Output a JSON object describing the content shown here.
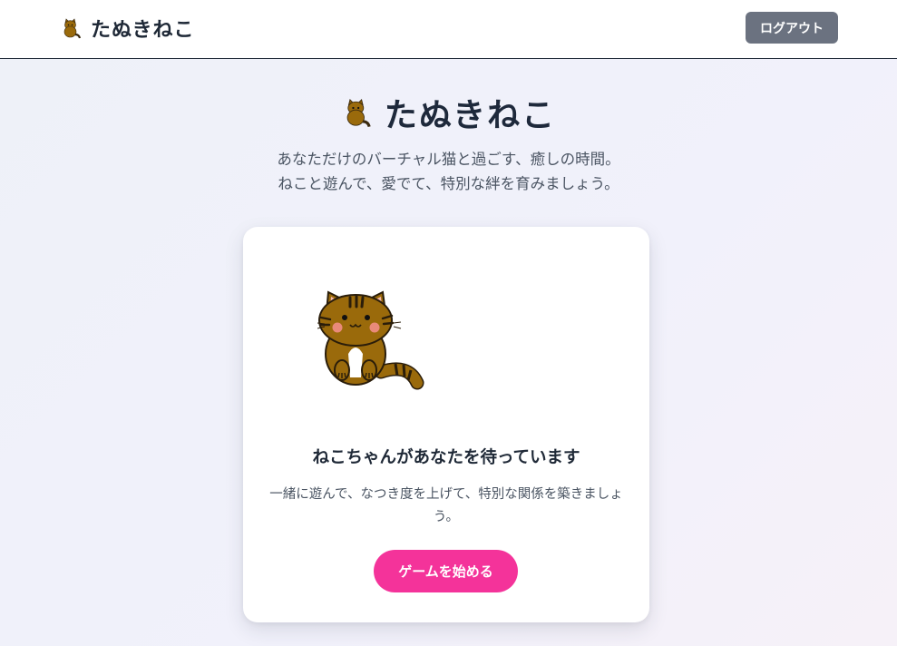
{
  "nav": {
    "brand_icon": "cat-icon",
    "brand_name": "たぬきねこ",
    "logout_label": "ログアウト"
  },
  "hero": {
    "icon": "cat-icon",
    "title": "たぬきねこ",
    "subtitle_line1": "あなただけのバーチャル猫と過ごす、癒しの時間。",
    "subtitle_line2": "ねこと遊んで、愛でて、特別な絆を育みましょう。"
  },
  "card": {
    "image": "tanuki-cat-illustration",
    "title": "ねこちゃんがあなたを待っています",
    "description": "一緒に遊んで、なつき度を上げて、特別な関係を築きましょう。",
    "button_label": "ゲームを始める"
  },
  "colors": {
    "primary_button": "#f4339a",
    "logout_button": "#6b7280",
    "cat_fur": "#9a6a0b"
  }
}
